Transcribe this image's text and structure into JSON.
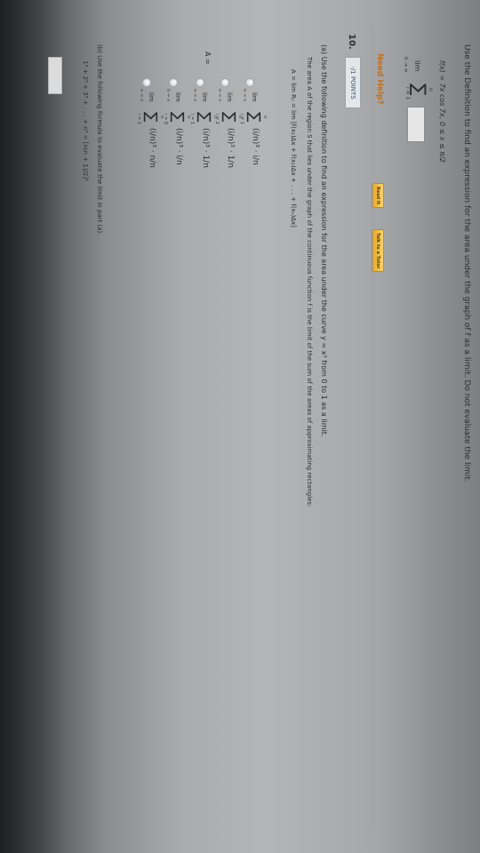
{
  "q9": {
    "instruction": "Use the Definition to find an expression for the area under the graph of f as a limit. Do not evaluate the limit.",
    "function": "f(x) = 7x cos 7x,     0 ≤ x ≤ π/2",
    "lim": "lim",
    "lim_sub": "n → ∞",
    "sigma_top": "n",
    "sigma_bottom": "i = 1",
    "need_help": "Need Help?",
    "read_it": "Read It",
    "talk_tutor": "Talk to a Tutor"
  },
  "q10": {
    "number": "10.",
    "points": "-/1 POINTS",
    "part_a": "(a) Use the following definition to find an expression for the area under the curve y = x³ from 0 to 1 as a limit.",
    "area_def_text": "The area A of the region S that lies under the graph of the continuous function f is the limit of the sum of the areas of approximating rectangles:",
    "area_formula": "A =  lim  Rₙ  =  lim  [f(x₁)Δx + f(x₂)Δx + . . . + f(xₙ)Δx]",
    "a_label": "A =",
    "choices": [
      {
        "lim": "lim",
        "sub": "n → ∞",
        "top": "n",
        "bot": "i = 1",
        "term": "(i/n)³ · i/n"
      },
      {
        "lim": "lim",
        "sub": "n → ∞",
        "top": "n",
        "bot": "i = 2",
        "term": "(i/n)³ · 1/n"
      },
      {
        "lim": "lim",
        "sub": "n → ∞",
        "top": "n",
        "bot": "i = 1",
        "term": "(i/n)³ · 1/n"
      },
      {
        "lim": "lim",
        "sub": "n → ∞",
        "top": "n",
        "bot": "i = 0",
        "term": "(i/n)³ · i/n"
      },
      {
        "lim": "lim",
        "sub": "n → ∞",
        "top": "n",
        "bot": "i = 1",
        "term": "(i/n)³ · n/n"
      }
    ],
    "part_b": "(b) Use the following formula to evaluate the limit in part (a).",
    "sum_formula": "1³ + 2³ + 3³ + . . . + n³ = [n(n + 1)/2]²"
  }
}
